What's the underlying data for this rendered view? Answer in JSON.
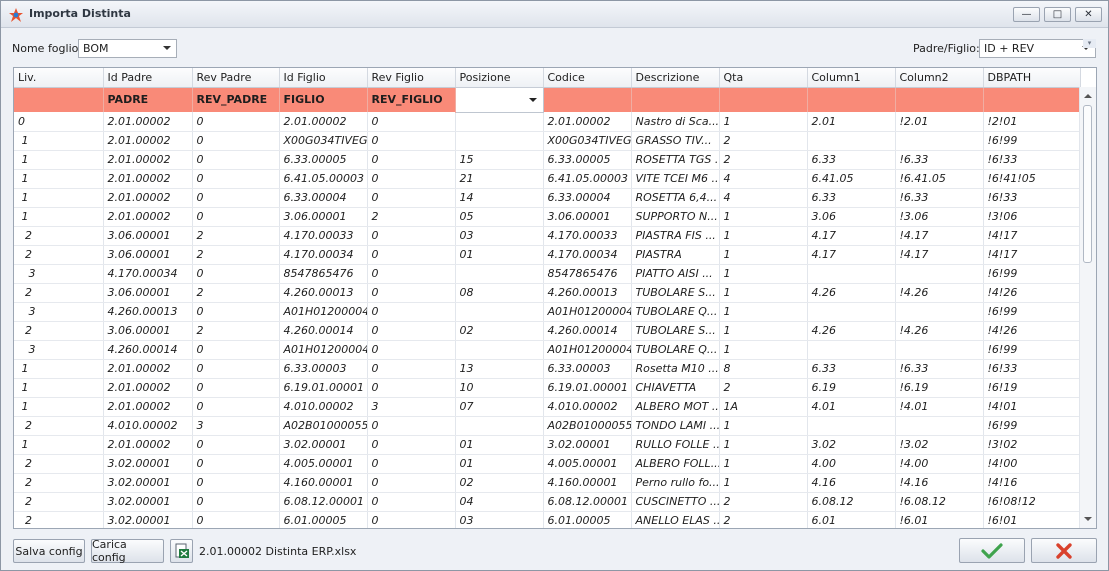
{
  "window": {
    "title": "Importa Distinta",
    "controls": {
      "minimize": "—",
      "maximize": "□",
      "close": "✕"
    }
  },
  "toolbar": {
    "sheet_label": "Nome foglio:",
    "sheet_value": "BOM",
    "parent_child_label": "Padre/Figlio:",
    "parent_child_value": "ID + REV"
  },
  "grid": {
    "columns": [
      "Liv.",
      "Id Padre",
      "Rev Padre",
      "Id Figlio",
      "Rev Figlio",
      "Posizione",
      "Codice",
      "Descrizione",
      "Qta",
      "Column1",
      "Column2",
      "DBPATH"
    ],
    "mapping": [
      "",
      "PADRE",
      "REV_PADRE",
      "FIGLIO",
      "REV_FIGLIO",
      "",
      "",
      "",
      "",
      "",
      "",
      ""
    ],
    "rows": [
      [
        "0",
        "2.01.00002",
        "0",
        "2.01.00002",
        "0",
        "",
        "2.01.00002",
        "Nastro di Sca...",
        "1",
        "2.01",
        "!2.01",
        "!2!01"
      ],
      [
        " 1",
        "2.01.00002",
        "0",
        "X00G034TIVEG",
        "0",
        "",
        "X00G034TIVEG",
        "GRASSO TIV...",
        "2",
        "",
        "",
        "!6!99"
      ],
      [
        " 1",
        "2.01.00002",
        "0",
        "6.33.00005",
        "0",
        "15",
        "6.33.00005",
        "ROSETTA TGS ...",
        "2",
        "6.33",
        "!6.33",
        "!6!33"
      ],
      [
        " 1",
        "2.01.00002",
        "0",
        "6.41.05.00003",
        "0",
        "21",
        "6.41.05.00003",
        "VITE TCEI M6 ...",
        "4",
        "6.41.05",
        "!6.41.05",
        "!6!41!05"
      ],
      [
        " 1",
        "2.01.00002",
        "0",
        "6.33.00004",
        "0",
        "14",
        "6.33.00004",
        "ROSETTA 6,4...",
        "4",
        "6.33",
        "!6.33",
        "!6!33"
      ],
      [
        " 1",
        "2.01.00002",
        "0",
        "3.06.00001",
        "2",
        "05",
        "3.06.00001",
        "SUPPORTO N...",
        "1",
        "3.06",
        "!3.06",
        "!3!06"
      ],
      [
        "  2",
        "3.06.00001",
        "2",
        "4.170.00033",
        "0",
        "03",
        "4.170.00033",
        "PIASTRA FIS ...",
        "1",
        "4.17",
        "!4.17",
        "!4!17"
      ],
      [
        "  2",
        "3.06.00001",
        "2",
        "4.170.00034",
        "0",
        "01",
        "4.170.00034",
        "PIASTRA",
        "1",
        "4.17",
        "!4.17",
        "!4!17"
      ],
      [
        "   3",
        "4.170.00034",
        "0",
        "8547865476",
        "0",
        "",
        "8547865476",
        "PIATTO AISI ...",
        "1",
        "",
        "",
        "!6!99"
      ],
      [
        "  2",
        "3.06.00001",
        "2",
        "4.260.00013",
        "0",
        "08",
        "4.260.00013",
        "TUBOLARE S...",
        "1",
        "4.26",
        "!4.26",
        "!4!26"
      ],
      [
        "   3",
        "4.260.00013",
        "0",
        "A01H01200004",
        "0",
        "",
        "A01H01200004",
        "TUBOLARE Q...",
        "1",
        "",
        "",
        "!6!99"
      ],
      [
        "  2",
        "3.06.00001",
        "2",
        "4.260.00014",
        "0",
        "02",
        "4.260.00014",
        "TUBOLARE S...",
        "1",
        "4.26",
        "!4.26",
        "!4!26"
      ],
      [
        "   3",
        "4.260.00014",
        "0",
        "A01H01200004",
        "0",
        "",
        "A01H01200004",
        "TUBOLARE Q...",
        "1",
        "",
        "",
        "!6!99"
      ],
      [
        " 1",
        "2.01.00002",
        "0",
        "6.33.00003",
        "0",
        "13",
        "6.33.00003",
        "Rosetta M10 ...",
        "8",
        "6.33",
        "!6.33",
        "!6!33"
      ],
      [
        " 1",
        "2.01.00002",
        "0",
        "6.19.01.00001",
        "0",
        "10",
        "6.19.01.00001",
        "CHIAVETTA",
        "2",
        "6.19",
        "!6.19",
        "!6!19"
      ],
      [
        " 1",
        "2.01.00002",
        "0",
        "4.010.00002",
        "3",
        "07",
        "4.010.00002",
        "ALBERO MOT ...",
        "1A",
        "4.01",
        "!4.01",
        "!4!01"
      ],
      [
        "  2",
        "4.010.00002",
        "3",
        "A02B01000055",
        "0",
        "",
        "A02B01000055",
        "TONDO LAMI ...",
        "1",
        "",
        "",
        "!6!99"
      ],
      [
        " 1",
        "2.01.00002",
        "0",
        "3.02.00001",
        "0",
        "01",
        "3.02.00001",
        "RULLO FOLLE ...",
        "1",
        "3.02",
        "!3.02",
        "!3!02"
      ],
      [
        "  2",
        "3.02.00001",
        "0",
        "4.005.00001",
        "0",
        "01",
        "4.005.00001",
        "ALBERO FOLL...",
        "1",
        "4.00",
        "!4.00",
        "!4!00"
      ],
      [
        "  2",
        "3.02.00001",
        "0",
        "4.160.00001",
        "0",
        "02",
        "4.160.00001",
        "Perno rullo fo...",
        "1",
        "4.16",
        "!4.16",
        "!4!16"
      ],
      [
        "  2",
        "3.02.00001",
        "0",
        "6.08.12.00001",
        "0",
        "04",
        "6.08.12.00001",
        "CUSCINETTO ...",
        "2",
        "6.08.12",
        "!6.08.12",
        "!6!08!12"
      ],
      [
        "  2",
        "3.02.00001",
        "0",
        "6.01.00005",
        "0",
        "03",
        "6.01.00005",
        "ANELLO ELAS ...",
        "2",
        "6.01",
        "!6.01",
        "!6!01"
      ]
    ]
  },
  "footer": {
    "save_config": "Salva config",
    "load_config": "Carica config",
    "file_name": "2.01.00002 Distinta ERP.xlsx",
    "icons": {
      "excel": "excel-file-icon",
      "ok": "checkmark-icon",
      "cancel": "cross-icon"
    },
    "colors": {
      "ok": "#3fa34d",
      "cancel": "#d9412c",
      "mapping_row": "#f98a78"
    }
  }
}
